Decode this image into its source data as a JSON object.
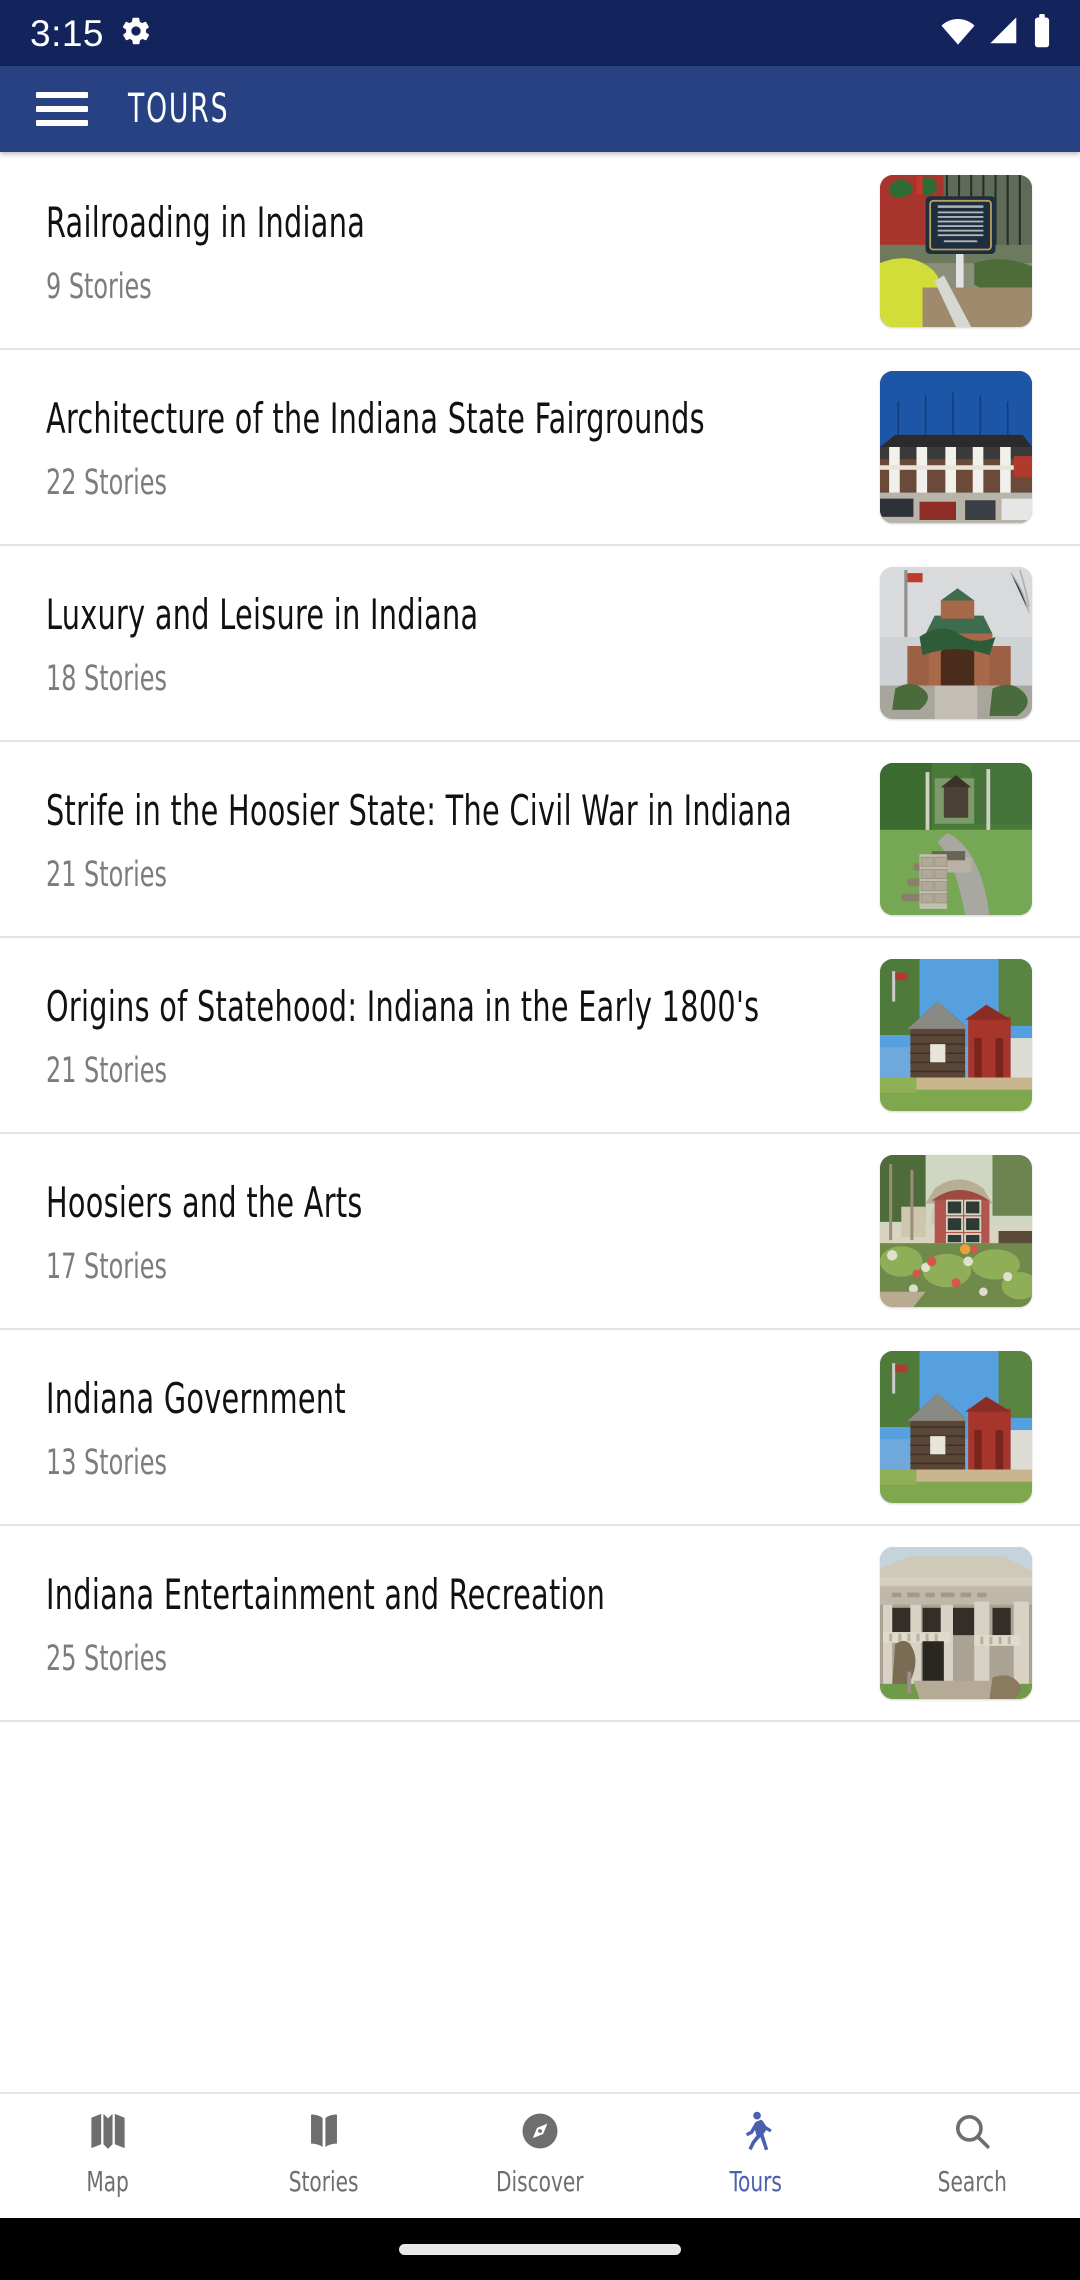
{
  "status_bar": {
    "time": "3:15",
    "icons": [
      "gear-icon",
      "wifi-icon",
      "cellular-signal-icon",
      "battery-icon"
    ],
    "background_color": "#13235c"
  },
  "app_bar": {
    "menu_icon": "hamburger-menu-icon",
    "title": "TOURS",
    "background_color": "#284183"
  },
  "tours": [
    {
      "title": "Railroading in Indiana",
      "stories": "9 Stories",
      "thumbnail": "historical-marker-with-red-train-and-green-fence"
    },
    {
      "title": "Architecture of the Indiana State Fairgrounds",
      "stories": "22 Stories",
      "thumbnail": "fairgrounds-grandstand-with-white-columns"
    },
    {
      "title": "Luxury and Leisure in Indiana",
      "stories": "18 Stories",
      "thumbnail": "brick-building-with-green-turret-and-flagpole"
    },
    {
      "title": "Strife in the Hoosier State: The Civil War in Indiana",
      "stories": "21 Stories",
      "thumbnail": "park-path-with-stone-monument-and-trees"
    },
    {
      "title": "Origins of Statehood: Indiana in the Early 1800's",
      "stories": "21 Stories",
      "thumbnail": "log-cabin-beside-red-building"
    },
    {
      "title": "Hoosiers and the Arts",
      "stories": "17 Stories",
      "thumbnail": "red-barn-studio-with-flower-garden"
    },
    {
      "title": "Indiana Government",
      "stories": "13 Stories",
      "thumbnail": "log-cabin-beside-red-building"
    },
    {
      "title": "Indiana Entertainment and Recreation",
      "stories": "25 Stories",
      "thumbnail": "limestone-neoclassical-building-with-columns"
    }
  ],
  "bottom_nav": {
    "active_index": 3,
    "active_color": "#4a5fb0",
    "inactive_color": "#6e6e6e",
    "items": [
      {
        "label": "Map",
        "icon": "folded-map-icon"
      },
      {
        "label": "Stories",
        "icon": "open-book-icon"
      },
      {
        "label": "Discover",
        "icon": "compass-icon"
      },
      {
        "label": "Tours",
        "icon": "walking-person-icon"
      },
      {
        "label": "Search",
        "icon": "magnifying-glass-icon"
      }
    ]
  }
}
